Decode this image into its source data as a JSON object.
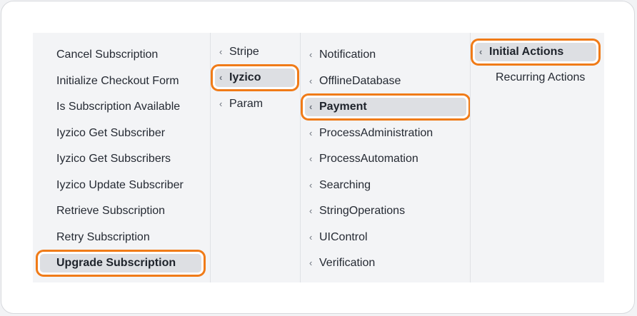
{
  "col1": {
    "items": [
      "Cancel Subscription",
      "Initialize Checkout Form",
      "Is Subscription Available",
      "Iyzico Get Subscriber",
      "Iyzico Get Subscribers",
      "Iyzico Update Subscriber",
      "Retrieve Subscription",
      "Retry Subscription",
      "Upgrade Subscription"
    ],
    "selected_index": 8
  },
  "col2": {
    "items": [
      "Stripe",
      "Iyzico",
      "Param"
    ],
    "selected_index": 1
  },
  "col3": {
    "items": [
      "Notification",
      "OfflineDatabase",
      "Payment",
      "ProcessAdministration",
      "ProcessAutomation",
      "Searching",
      "StringOperations",
      "UIControl",
      "Verification"
    ],
    "selected_index": 2
  },
  "col4": {
    "items": [
      "Initial Actions",
      "Recurring Actions"
    ],
    "selected_index": 0
  },
  "icons": {
    "submenu": "chevron-left-icon"
  },
  "colors": {
    "highlight_border": "#f07b18",
    "selected_bg": "#dddfe3",
    "menu_bg": "#f3f4f6"
  },
  "chevron_glyph": "‹"
}
